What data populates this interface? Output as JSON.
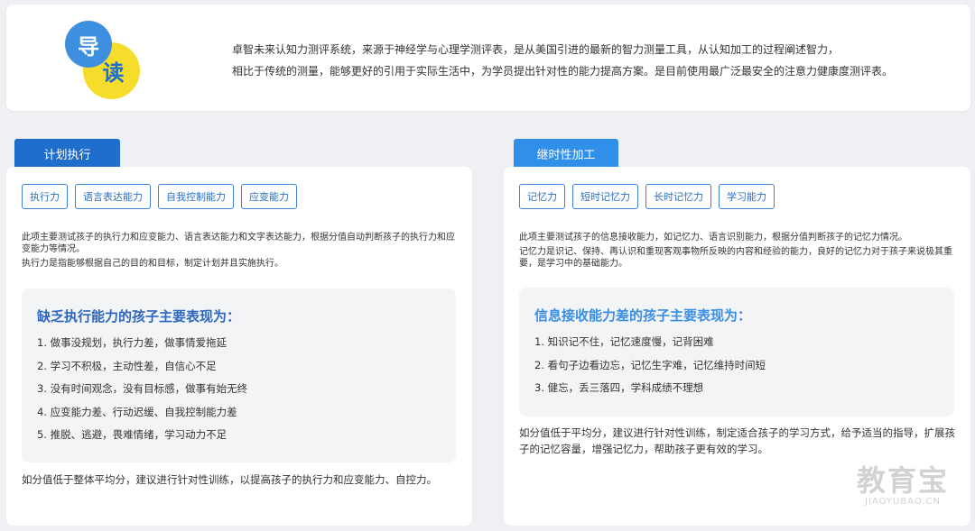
{
  "header": {
    "logo_char_1": "导",
    "logo_char_2": "读",
    "intro_line_1": "卓智未来认知力测评系统，来源于神经学与心理学测评表，是从美国引进的最新的智力测量工具，从认知加工的过程阐述智力，",
    "intro_line_2": "相比于传统的测量，能够更好的引用于实际生活中，为学员提出针对性的能力提高方案。是目前使用最广泛最安全的注意力健康度测评表。",
    "logo_colors": {
      "blue": "#3f8fe0",
      "yellow": "#f7dd2b"
    }
  },
  "left_panel": {
    "tab": "计划执行",
    "tags": [
      "执行力",
      "语言表达能力",
      "自我控制能力",
      "应变能力"
    ],
    "desc_1": "此项主要测试孩子的执行力和应变能力、语言表达能力和文字表达能力，根据分值自动判断孩子的执行力和应变能力等情况。",
    "desc_2": "执行力是指能够根据自己的目的和目标，制定计划并且实施执行。",
    "box_title": "缺乏执行能力的孩子主要表现为：",
    "items": [
      "1. 做事没规划，执行力差，做事情爱拖延",
      "2. 学习不积极，主动性差，自信心不足",
      "3. 没有时间观念，没有目标感，做事有始无终",
      "4. 应变能力差、行动迟缓、自我控制能力差",
      "5. 推脱、逃避，畏难情绪，学习动力不足"
    ],
    "advice": "如分值低于整体平均分，建议进行针对性训练，以提高孩子的执行力和应变能力、自控力。",
    "tab_color": "#1f6dcc"
  },
  "right_panel": {
    "tab": "继时性加工",
    "tags": [
      "记忆力",
      "短时记忆力",
      "长时记忆力",
      "学习能力"
    ],
    "desc_1": "此项主要测试孩子的信息接收能力，如记忆力、语言识别能力，根据分值判断孩子的记忆力情况。",
    "desc_2": "记忆力是识记、保持、再认识和重现客观事物所反映的内容和经验的能力，良好的记忆力对于孩子来说极其重要，是学习中的基础能力。",
    "box_title": "信息接收能力差的孩子主要表现为：",
    "items": [
      "1. 知识记不住，记忆速度慢，记背困难",
      "2. 看句子边看边忘，记忆生字难，记忆维持时间短",
      "3. 健忘，丢三落四，学科成绩不理想"
    ],
    "advice": "如分值低于平均分，建议进行针对性训练，制定适合孩子的学习方式，给予适当的指导，扩展孩子的记忆容量，增强记忆力，帮助孩子更有效的学习。",
    "tab_color": "#2f8fe9"
  },
  "watermark": {
    "main": "教育宝",
    "sub": "JIAOYUBAO.CN"
  }
}
